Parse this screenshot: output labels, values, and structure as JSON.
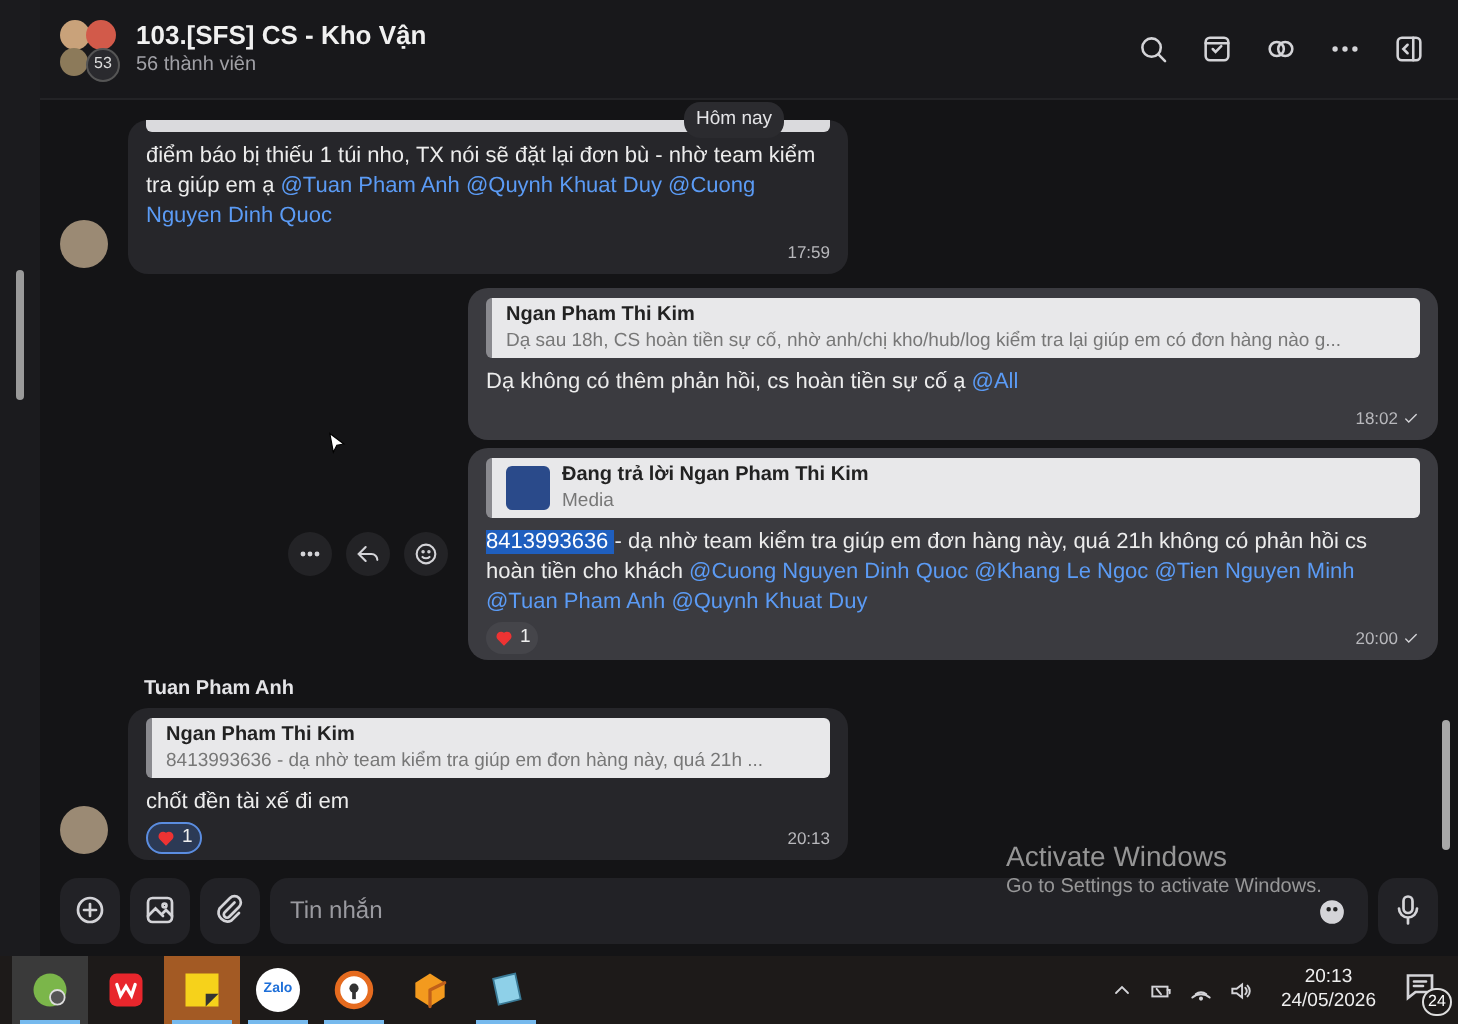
{
  "header": {
    "title": "103.[SFS] CS - Kho Vận",
    "member_badge": "53",
    "subtitle": "56 thành viên"
  },
  "date_pill": "Hôm nay",
  "messages": [
    {
      "kind": "incoming",
      "quote_cut": true,
      "segments": [
        {
          "kind": "plain",
          "text": "điểm báo bị thiếu 1 túi nho, TX nói sẽ đặt lại đơn bù - nhờ team kiểm tra giúp em ạ "
        },
        {
          "kind": "mention",
          "text": "@Tuan Pham Anh "
        },
        {
          "kind": "mention",
          "text": "@Quynh Khuat Duy "
        },
        {
          "kind": "mention",
          "text": "@Cuong Nguyen Dinh Quoc"
        }
      ],
      "time": "17:59",
      "read": false
    },
    {
      "kind": "outgoing",
      "quote": {
        "author": "Ngan Pham Thi Kim",
        "text": "Dạ sau 18h, CS hoàn tiền sự cố, nhờ anh/chị kho/hub/log kiểm tra lại giúp em có đơn hàng nào g...",
        "thumb": false
      },
      "segments": [
        {
          "kind": "plain",
          "text": "Dạ không có thêm phản hồi, cs hoàn tiền sự cố ạ "
        },
        {
          "kind": "mention",
          "text": "@All"
        }
      ],
      "time": "18:02",
      "read": true
    },
    {
      "kind": "outgoing",
      "actions": true,
      "quote": {
        "author": "Đang trả lời Ngan Pham Thi Kim",
        "text": "Media",
        "thumb": true
      },
      "segments": [
        {
          "kind": "highlight",
          "text": "8413993636 "
        },
        {
          "kind": "plain",
          "text": " - dạ nhờ team kiểm tra giúp em đơn hàng này, quá 21h không có phản hồi cs hoàn tiền cho khách "
        },
        {
          "kind": "mention",
          "text": "@Cuong Nguyen Dinh Quoc "
        },
        {
          "kind": "mention",
          "text": "@Khang Le Ngoc "
        },
        {
          "kind": "mention",
          "text": "@Tien Nguyen Minh "
        },
        {
          "kind": "mention",
          "text": "@Tuan Pham Anh "
        },
        {
          "kind": "mention",
          "text": "@Quynh Khuat Duy"
        }
      ],
      "reaction": {
        "count": "1",
        "mine": false
      },
      "time": "20:00",
      "read": true
    },
    {
      "kind": "incoming",
      "sender": "Tuan Pham Anh",
      "quote": {
        "author": "Ngan Pham Thi Kim",
        "text": "8413993636 - dạ nhờ team kiểm tra giúp em đơn hàng này, quá 21h ...",
        "thumb": false
      },
      "segments": [
        {
          "kind": "plain",
          "text": "chốt đền tài xế đi em"
        }
      ],
      "reaction": {
        "count": "1",
        "mine": true
      },
      "time": "20:13",
      "read": false
    }
  ],
  "composer": {
    "placeholder": "Tin nhắn"
  },
  "os_notice": {
    "title": "Activate Windows",
    "text": "Go to Settings to activate Windows."
  },
  "taskbar": {
    "apps": [
      {
        "kind": "green",
        "active": true
      },
      {
        "kind": "wps",
        "active": false
      },
      {
        "kind": "notes",
        "active": true,
        "selected": true
      },
      {
        "kind": "zalo",
        "label": "Zalo",
        "active": true
      },
      {
        "kind": "keyhole",
        "active": true
      },
      {
        "kind": "hex",
        "active": false
      },
      {
        "kind": "notepad",
        "active": true
      }
    ],
    "time": "20:13",
    "date": "24/05/2026",
    "notifications": "24"
  }
}
